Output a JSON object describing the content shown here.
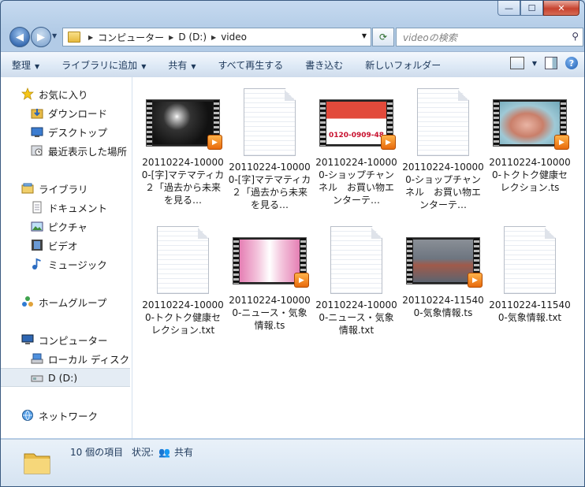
{
  "window": {
    "minimize": "—",
    "maximize": "☐",
    "close": "✕"
  },
  "address": {
    "crumbs": [
      "コンピューター",
      "D (D:)",
      "video"
    ]
  },
  "search": {
    "placeholder": "videoの検索"
  },
  "toolbar": {
    "items": [
      "整理",
      "ライブラリに追加",
      "共有",
      "すべて再生する",
      "書き込む",
      "新しいフォルダー"
    ],
    "help": "?"
  },
  "navpane": {
    "favorites": "お気に入り",
    "favorites_items": [
      "ダウンロード",
      "デスクトップ",
      "最近表示した場所"
    ],
    "libraries": "ライブラリ",
    "libraries_items": [
      "ドキュメント",
      "ピクチャ",
      "ビデオ",
      "ミュージック"
    ],
    "homegroup": "ホームグループ",
    "computer": "コンピューター",
    "computer_items": [
      "ローカル ディスク (",
      "D (D:)"
    ],
    "network": "ネットワーク"
  },
  "files": [
    {
      "name": "20110224-100000-[字]マテマティカ２「過去から未来を見る…",
      "type": "video",
      "thumb": "night"
    },
    {
      "name": "20110224-100000-[字]マテマティカ２「過去から未来を見る…",
      "type": "text"
    },
    {
      "name": "20110224-100000-ショップチャンネル　お買い物エンターテ…",
      "type": "video",
      "thumb": "shop",
      "caption": "0120-0909-48"
    },
    {
      "name": "20110224-100000-ショップチャンネル　お買い物エンターテ…",
      "type": "text"
    },
    {
      "name": "20110224-100000-トクトク健康セレクション.ts",
      "type": "video",
      "thumb": "health"
    },
    {
      "name": "20110224-100000-トクトク健康セレクション.txt",
      "type": "text"
    },
    {
      "name": "20110224-100000-ニュース・気象情報.ts",
      "type": "video",
      "thumb": "news"
    },
    {
      "name": "20110224-100000-ニュース・気象情報.txt",
      "type": "text"
    },
    {
      "name": "20110224-115400-気象情報.ts",
      "type": "video",
      "thumb": "weather"
    },
    {
      "name": "20110224-115400-気象情報.txt",
      "type": "text"
    }
  ],
  "status": {
    "count": "10 個の項目",
    "state_label": "状況:",
    "state_value": "共有"
  },
  "colors": {
    "accent": "#1e395b",
    "selection": "#e4ecf4",
    "play": "#e86a0c"
  }
}
